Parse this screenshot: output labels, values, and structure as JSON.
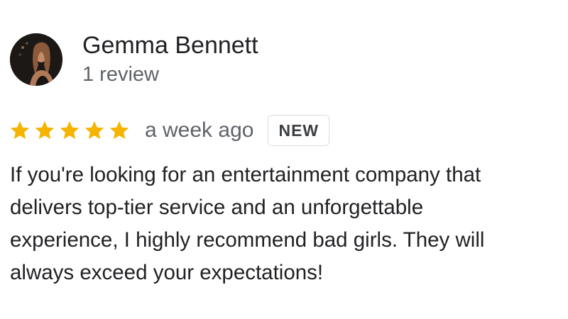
{
  "reviewer": {
    "name": "Gemma Bennett",
    "review_count": "1 review",
    "avatar": "profile-photo"
  },
  "review": {
    "rating": 5,
    "rating_max": 5,
    "time": "a week ago",
    "badge": "NEW",
    "lines": [
      "If you're looking for an entertainment company that",
      "delivers top-tier service and an unforgettable",
      "experience, I highly recommend bad girls. They will",
      "always exceed your expectations!"
    ]
  },
  "colors": {
    "star": "#F4B400",
    "name": "#202124",
    "secondary": "#5F6368",
    "badge_border": "#DADCE0"
  },
  "icons": {
    "star": "star-icon"
  }
}
